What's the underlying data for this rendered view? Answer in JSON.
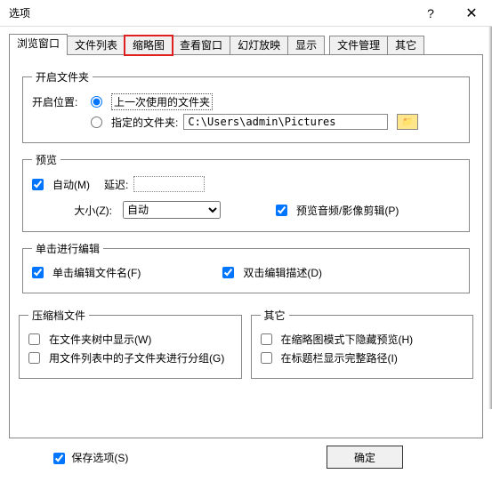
{
  "window": {
    "title": "选项",
    "help": "?",
    "close": "✕"
  },
  "tabs": [
    "浏览窗口",
    "文件列表",
    "缩略图",
    "查看窗口",
    "幻灯放映",
    "显示",
    "文件管理",
    "其它"
  ],
  "groups": {
    "open_folder": {
      "legend": "开启文件夹",
      "label": "开启位置:",
      "opt_last": "上一次使用的文件夹",
      "opt_fixed": "指定的文件夹:",
      "path": "C:\\Users\\admin\\Pictures"
    },
    "preview": {
      "legend": "预览",
      "auto": "自动(M)",
      "delay": "延迟:",
      "size_label": "大小(Z):",
      "size_value": "自动",
      "audio_video": "预览音频/影像剪辑(P)"
    },
    "click_edit": {
      "legend": "单击进行编辑",
      "click_name": "单击编辑文件名(F)",
      "dblclick_desc": "双击编辑描述(D)"
    },
    "archive": {
      "legend": "压缩档文件",
      "show_in_tree": "在文件夹树中显示(W)",
      "group_sub": "用文件列表中的子文件夹进行分组(G)"
    },
    "misc": {
      "legend": "其它",
      "hide_preview": "在缩略图模式下隐藏预览(H)",
      "titlebar_path": "在标题栏显示完整路径(I)"
    }
  },
  "footer": {
    "save_opts": "保存选项(S)",
    "ok": "确定"
  }
}
